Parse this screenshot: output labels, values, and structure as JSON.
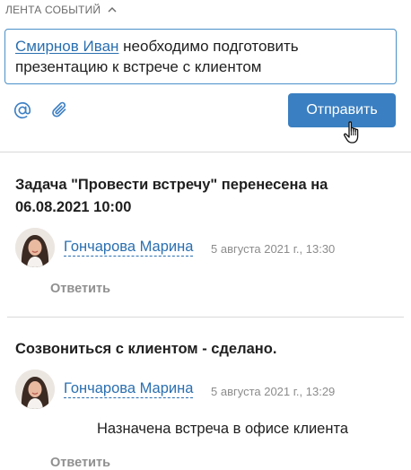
{
  "feed": {
    "title": "ЛЕНТА СОБЫТИЙ"
  },
  "composer": {
    "mention": "Смирнов Иван",
    "text": " необходимо подготовить презентацию к встрече с клиентом",
    "send_label": "Отправить",
    "icons": [
      "at-icon",
      "paperclip-icon"
    ]
  },
  "events": [
    {
      "title": "Задача \"Провести встречу\" перенесена на 06.08.2021 10:00",
      "author": "Гончарова Марина",
      "date": "5 августа 2021 г., 13:30",
      "reply_label": "Ответить"
    },
    {
      "title": "Созвониться с клиентом - сделано.",
      "author": "Гончарова Марина",
      "date": "5 августа 2021 г., 13:29",
      "comment": "Назначена встреча в офисе клиента",
      "reply_label": "Ответить"
    }
  ],
  "colors": {
    "accent": "#3a7fc1",
    "link": "#2a6fb0",
    "muted": "#8c8c8c",
    "divider": "#d9d9d9"
  }
}
